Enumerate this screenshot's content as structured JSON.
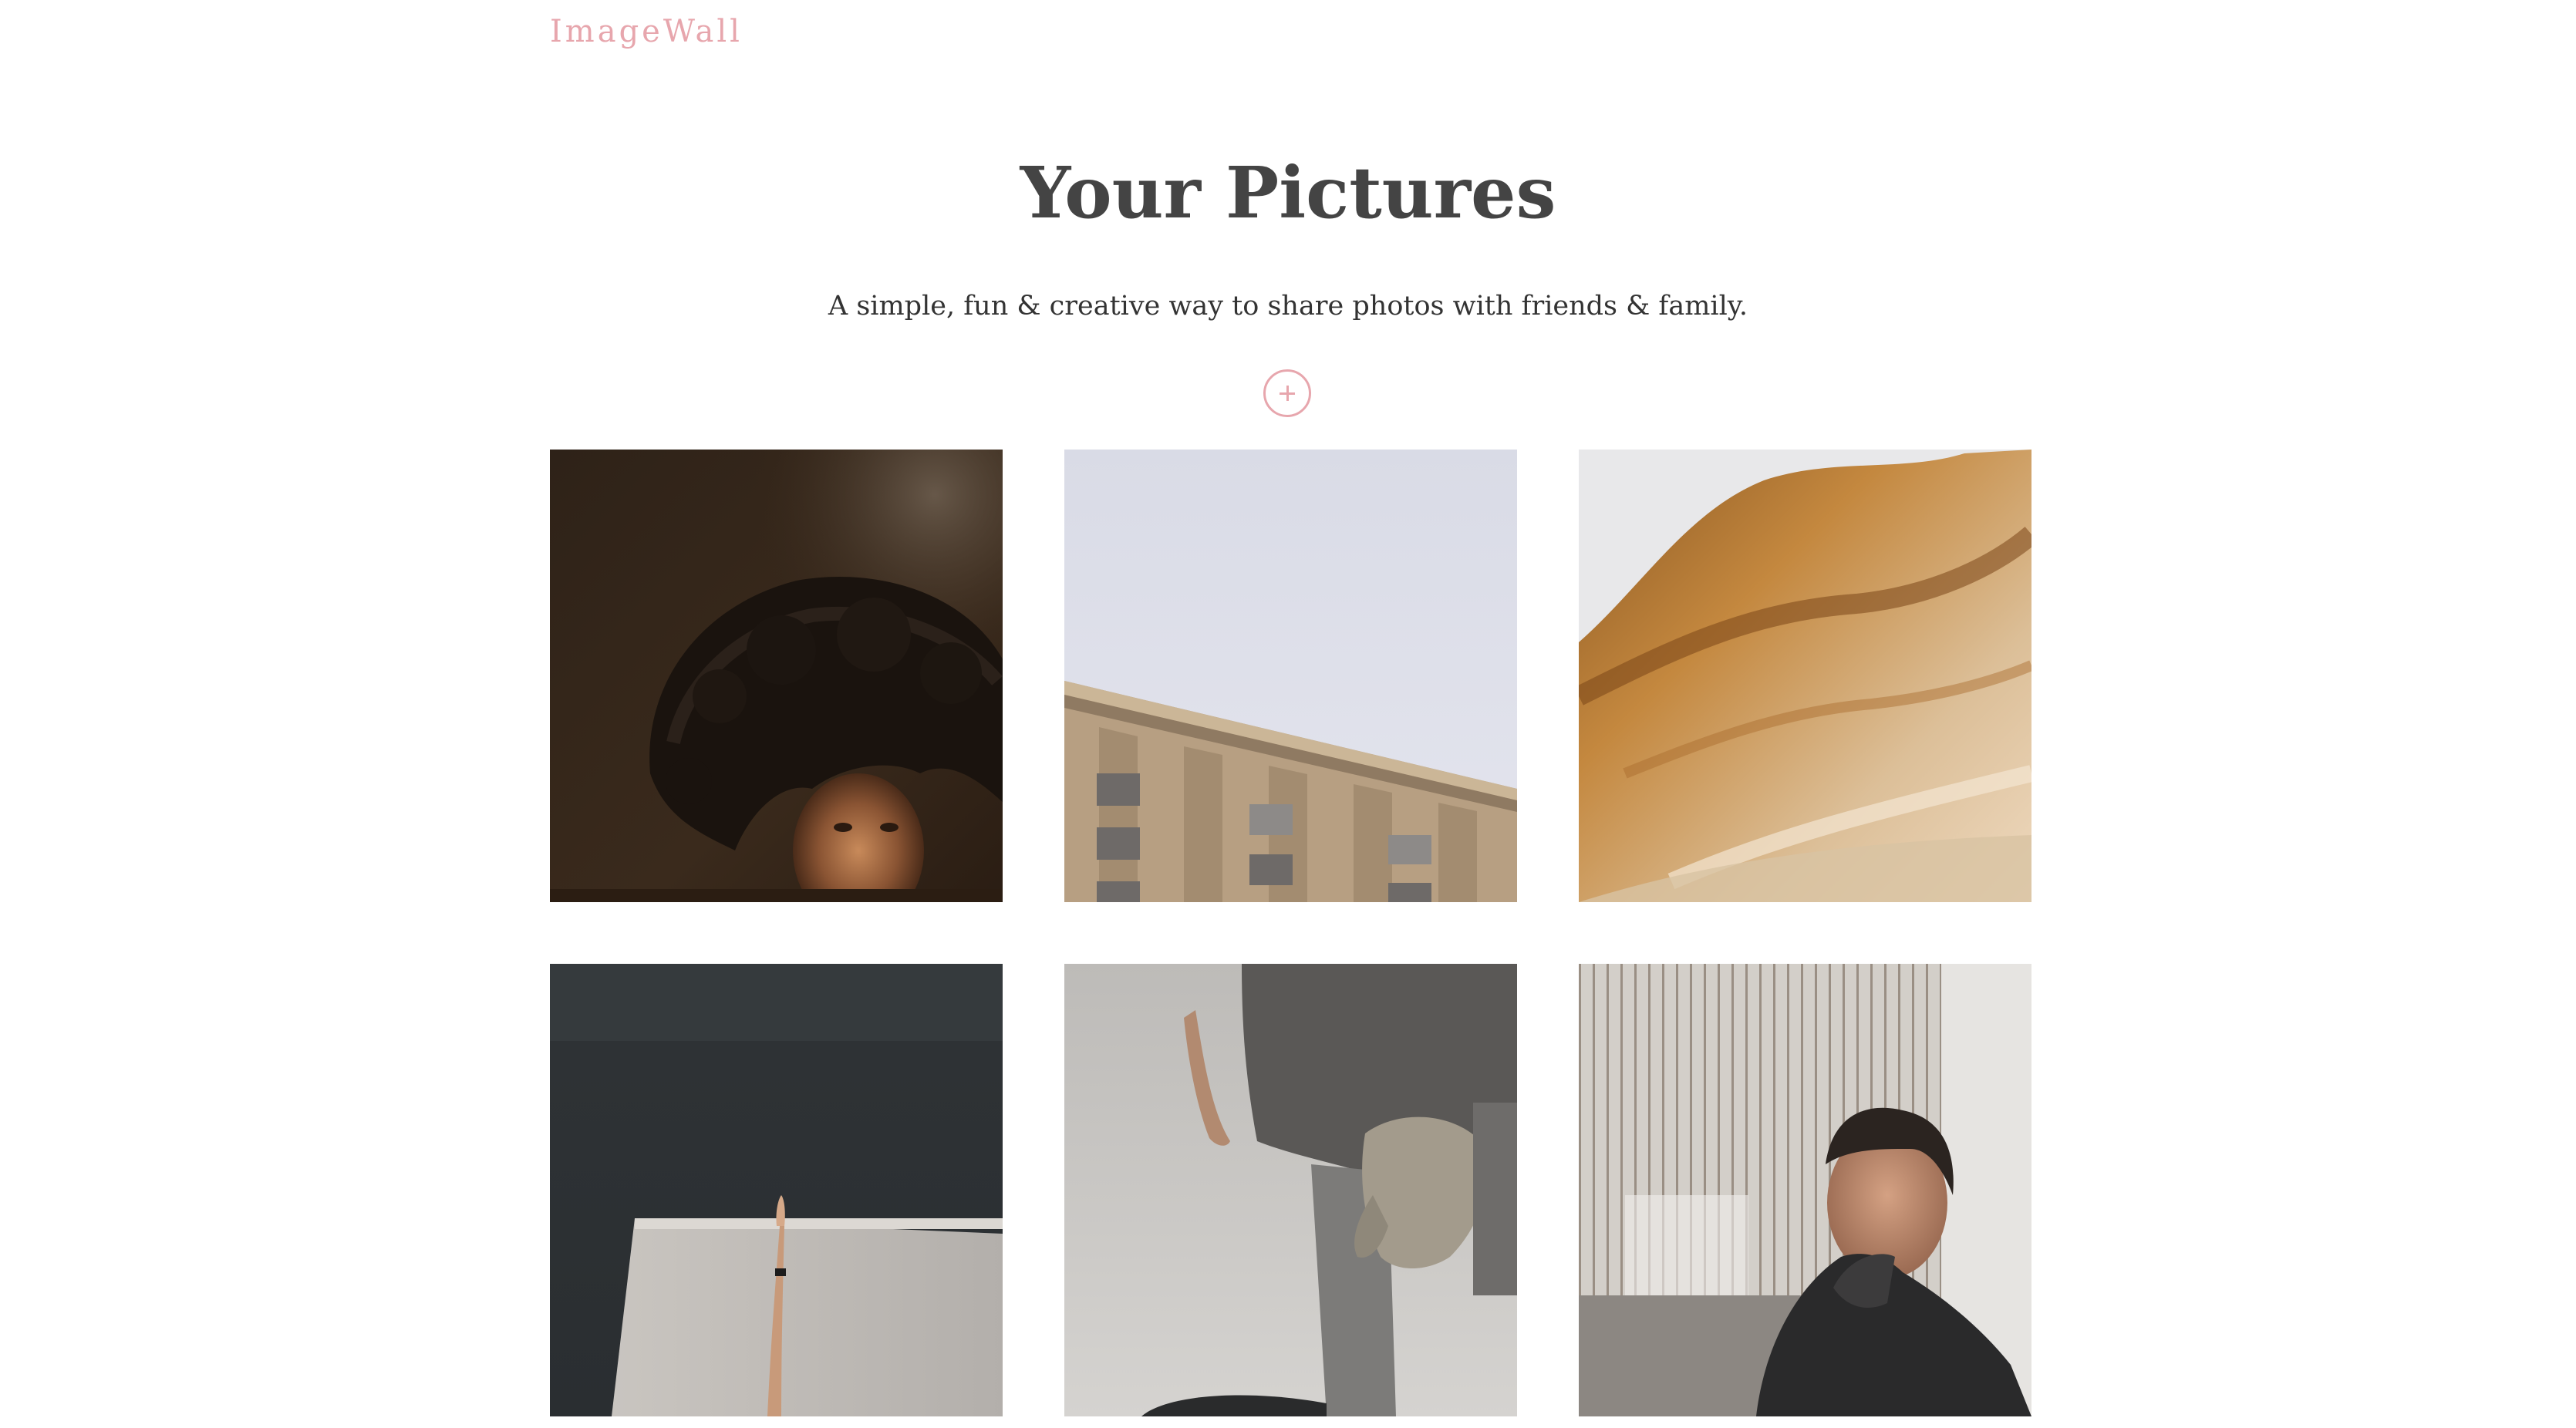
{
  "header": {
    "brand": "ImageWall"
  },
  "hero": {
    "title": "Your Pictures",
    "subtitle": "A simple, fun & creative way to share photos with friends & family."
  },
  "actions": {
    "add_button_icon": "plus-icon"
  },
  "colors": {
    "accent": "#e7a6ad",
    "heading": "#444444",
    "text": "#333333",
    "background": "#ffffff"
  },
  "photos": [
    {
      "subject": "portrait-curly-hair"
    },
    {
      "subject": "building-facade-sky"
    },
    {
      "subject": "dried-leaf-closeup"
    },
    {
      "subject": "raised-arm-studio"
    },
    {
      "subject": "hand-with-work-glove"
    },
    {
      "subject": "portrait-woman-industrial"
    }
  ]
}
